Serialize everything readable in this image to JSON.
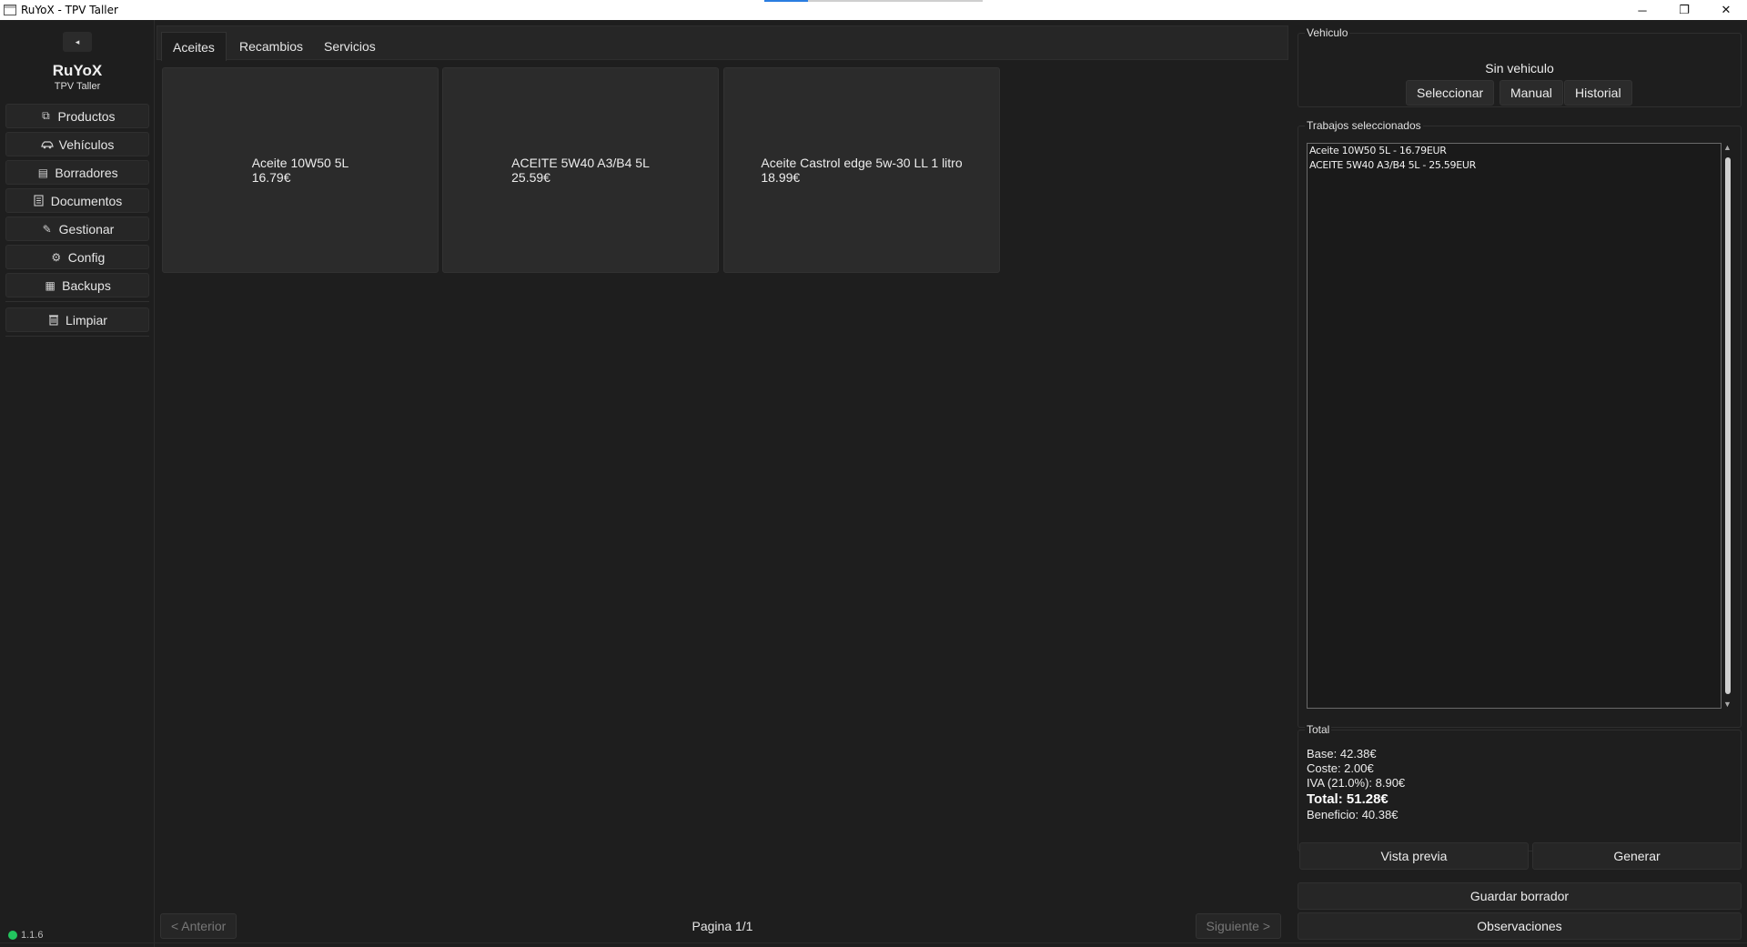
{
  "window": {
    "title": "RuYoX - TPV Taller",
    "controls": {
      "minimize": "─",
      "restore": "❐",
      "close": "✕"
    }
  },
  "sidebar": {
    "collapse_glyph": "◂",
    "brand": "RuYoX",
    "brand_sub": "TPV Taller",
    "items": [
      {
        "label": "Productos",
        "icon": "box-icon",
        "glyph": "⧉"
      },
      {
        "label": "Vehículos",
        "icon": "car-icon",
        "glyph": "🚗"
      },
      {
        "label": "Borradores",
        "icon": "drafts-icon",
        "glyph": "▤"
      },
      {
        "label": "Documentos",
        "icon": "document-icon",
        "glyph": "▭"
      },
      {
        "label": "Gestionar",
        "icon": "pencil-icon",
        "glyph": "✎"
      },
      {
        "label": "Config",
        "icon": "gear-icon",
        "glyph": "⚙"
      },
      {
        "label": "Backups",
        "icon": "backup-icon",
        "glyph": "▦"
      }
    ],
    "clear": {
      "label": "Limpiar",
      "icon": "trash-icon",
      "glyph": "🗑"
    },
    "version": "1.1.6"
  },
  "tabs": [
    {
      "label": "Aceites",
      "active": true
    },
    {
      "label": "Recambios",
      "active": false
    },
    {
      "label": "Servicios",
      "active": false
    }
  ],
  "products": [
    {
      "name": "Aceite 10W50 5L",
      "price": "16.79€"
    },
    {
      "name": "ACEITE 5W40 A3/B4 5L",
      "price": "25.59€"
    },
    {
      "name": "Aceite Castrol edge 5w-30 LL 1 litro",
      "price": "18.99€"
    }
  ],
  "pager": {
    "prev": "< Anterior",
    "label": "Pagina 1/1",
    "next": "Siguiente >"
  },
  "vehicle": {
    "title": "Vehiculo",
    "status": "Sin vehiculo",
    "buttons": {
      "select": "Seleccionar",
      "manual": "Manual",
      "history": "Historial"
    }
  },
  "jobs": {
    "title": "Trabajos seleccionados",
    "items": [
      "Aceite 10W50 5L - 16.79EUR",
      "ACEITE 5W40 A3/B4 5L - 25.59EUR"
    ]
  },
  "totals": {
    "title": "Total",
    "base": "Base: 42.38€",
    "coste": "Coste: 2.00€",
    "iva": "IVA (21.0%): 8.90€",
    "total": "Total: 51.28€",
    "beneficio": "Beneficio: 40.38€"
  },
  "actions": {
    "preview": "Vista previa",
    "generate": "Generar",
    "save_draft": "Guardar borrador",
    "notes": "Observaciones"
  }
}
